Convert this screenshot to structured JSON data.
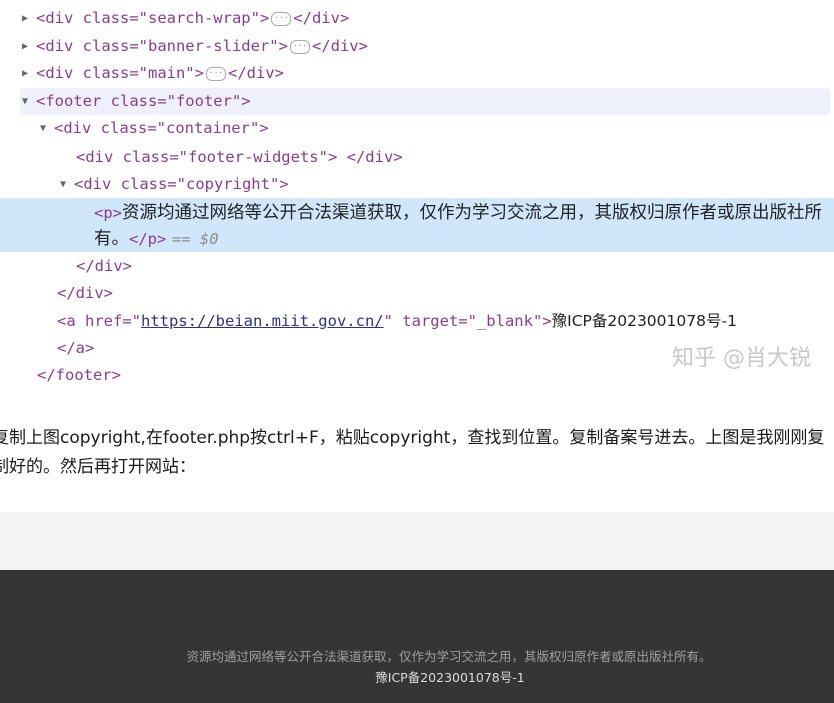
{
  "devtools": {
    "lines": {
      "search_wrap": {
        "open": "<div class=\"search-wrap\">",
        "close": "</div>"
      },
      "banner_slider": {
        "open": "<div class=\"banner-slider\">",
        "close": "</div>"
      },
      "main": {
        "open": "<div class=\"main\">",
        "close": "</div>"
      },
      "footer_open": "<footer class=\"footer\">",
      "container_open": "<div class=\"container\">",
      "footer_widgets": "<div class=\"footer-widgets\"> </div>",
      "copyright_open": "<div class=\"copyright\">",
      "p_open": "<p>",
      "p_text": "资源均通过网络等公开合法渠道获取，仅作为学习交流之用，其版权归原作者或原出版社所有。",
      "p_close": "</p>",
      "p_eq": "== $0",
      "div_close_1": "</div>",
      "div_close_2": "</div>",
      "a_open_prefix": "<a href=\"",
      "a_href": "https://beian.miit.gov.cn/",
      "a_open_suffix": "\" target=\"_blank\">",
      "a_text": "豫ICP备2023001078号-1",
      "a_close": "</a>",
      "footer_close": "</footer>"
    },
    "watermark": "知乎 @肖大锐"
  },
  "article": {
    "paragraph": "复制上图copyright,在footer.php按ctrl+F，粘贴copyright，查找到位置。复制备案号进去。上图是我刚刚复制好的。然后再打开网站："
  },
  "site_footer": {
    "copyright": "资源均通过网络等公开合法渠道获取，仅作为学习交流之用，其版权归原作者或原出版社所有。",
    "icp": "豫ICP备2023001078号-1"
  },
  "colors": {
    "tag": "#8d3b8e",
    "value": "#2b3190",
    "selection": "#d0e6fb",
    "footer_bg": "#353535"
  }
}
